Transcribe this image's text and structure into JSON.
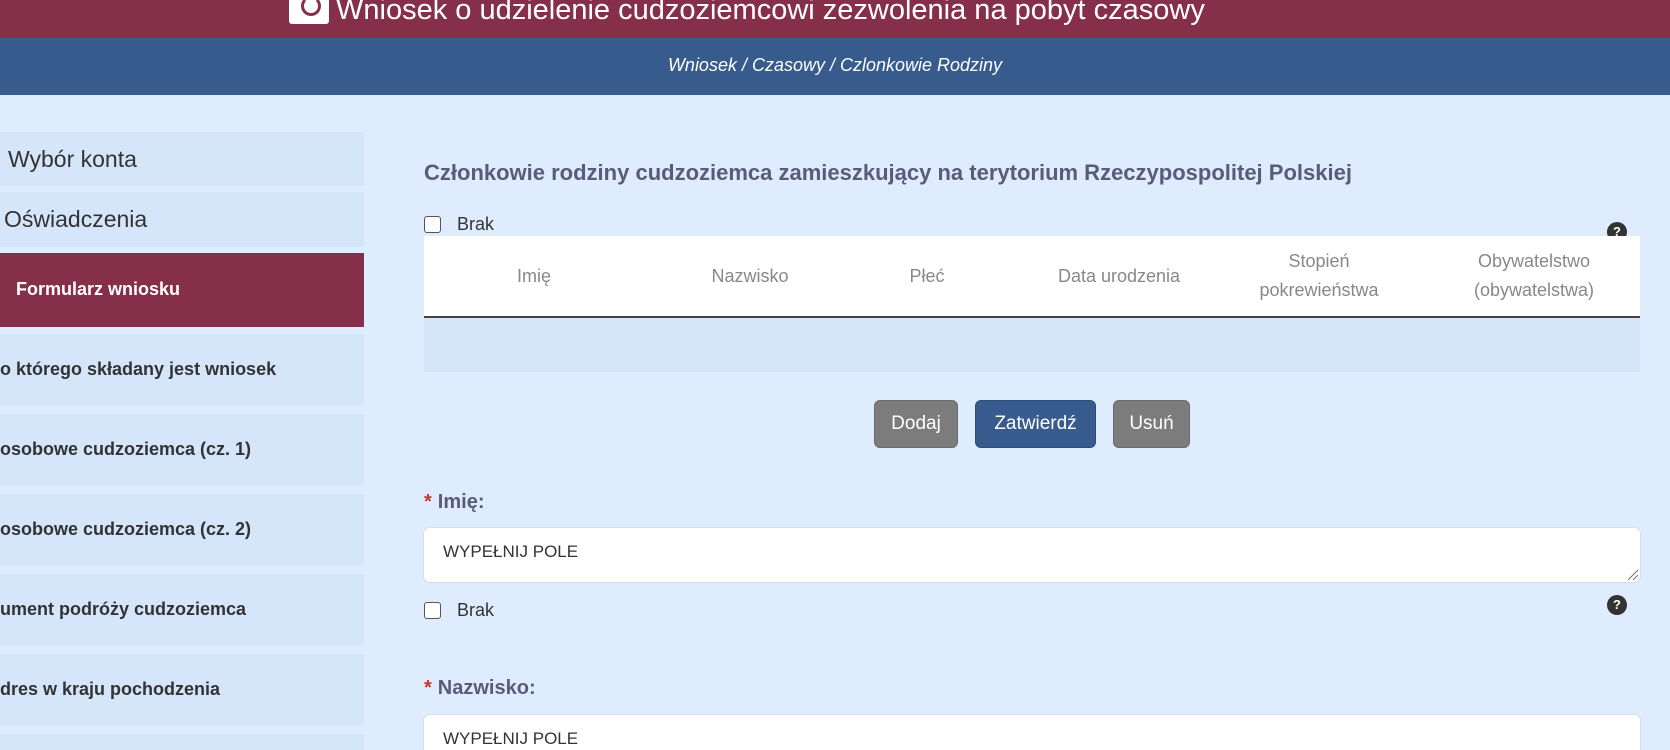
{
  "header": {
    "title": "Wniosek o udzielenie cudzoziemcowi zezwolenia na pobyt czasowy",
    "breadcrumb": "Wniosek / Czasowy / Czlonkowie Rodziny"
  },
  "sidebar": {
    "items": [
      {
        "label": "Wybór konta"
      },
      {
        "label": "Oświadczenia"
      },
      {
        "label": "Formularz wniosku"
      },
      {
        "label": "o którego składany jest wniosek"
      },
      {
        "label": "osobowe cudzoziemca (cz. 1)"
      },
      {
        "label": "osobowe cudzoziemca (cz. 2)"
      },
      {
        "label": "ument podróży cudzoziemca"
      },
      {
        "label": "dres w kraju pochodzenia"
      }
    ]
  },
  "section": {
    "title": "Członkowie rodziny cudzoziemca zamieszkujący na terytorium Rzeczypospolitej Polskiej",
    "none_label": "Brak",
    "help_glyph": "?"
  },
  "table": {
    "columns": [
      "Imię",
      "Nazwisko",
      "Płeć",
      "Data urodzenia",
      "Stopień pokrewieństwa",
      "Obywatelstwo (obywatelstwa)"
    ]
  },
  "buttons": {
    "add": "Dodaj",
    "confirm": "Zatwierdź",
    "remove": "Usuń"
  },
  "form": {
    "required_mark": "*",
    "first_name_label": "Imię:",
    "first_name_value": "WYPEŁNIJ POLE",
    "first_name_none": "Brak",
    "last_name_label": "Nazwisko:",
    "last_name_value": "WYPEŁNIJ POLE"
  },
  "colors": {
    "header_bg": "#862f4b",
    "breadcrumb_bg": "#365b8c",
    "page_bg": "#deecfd",
    "active_item": "#862f4b"
  }
}
